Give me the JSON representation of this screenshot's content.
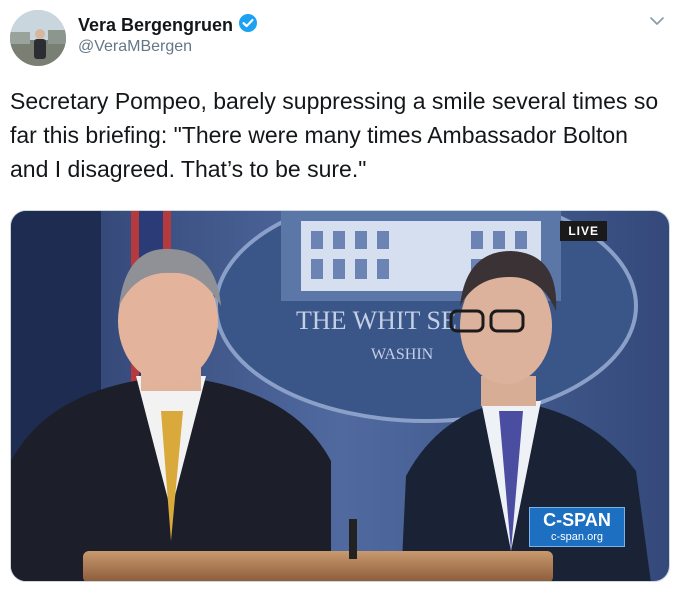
{
  "author": {
    "display_name": "Vera Bergengruen",
    "handle": "@VeraMBergen",
    "verified_icon": "verified-badge-icon"
  },
  "tweet": {
    "text": "Secretary Pompeo, barely suppressing a smile several times so far this briefing: \"There were many times Ambassador Bolton and I disagreed. That’s to be sure.\""
  },
  "media": {
    "live_badge": "LIVE",
    "seal_text_top": "THE WHIT SE",
    "seal_text_bottom": "WASHIN",
    "network_logo": "C-SPAN",
    "network_url": "c-span.org"
  },
  "colors": {
    "accent": "#1da1f2",
    "text": "#14171a",
    "secondary_text": "#657786",
    "cspan_blue": "#1d6fc1"
  }
}
